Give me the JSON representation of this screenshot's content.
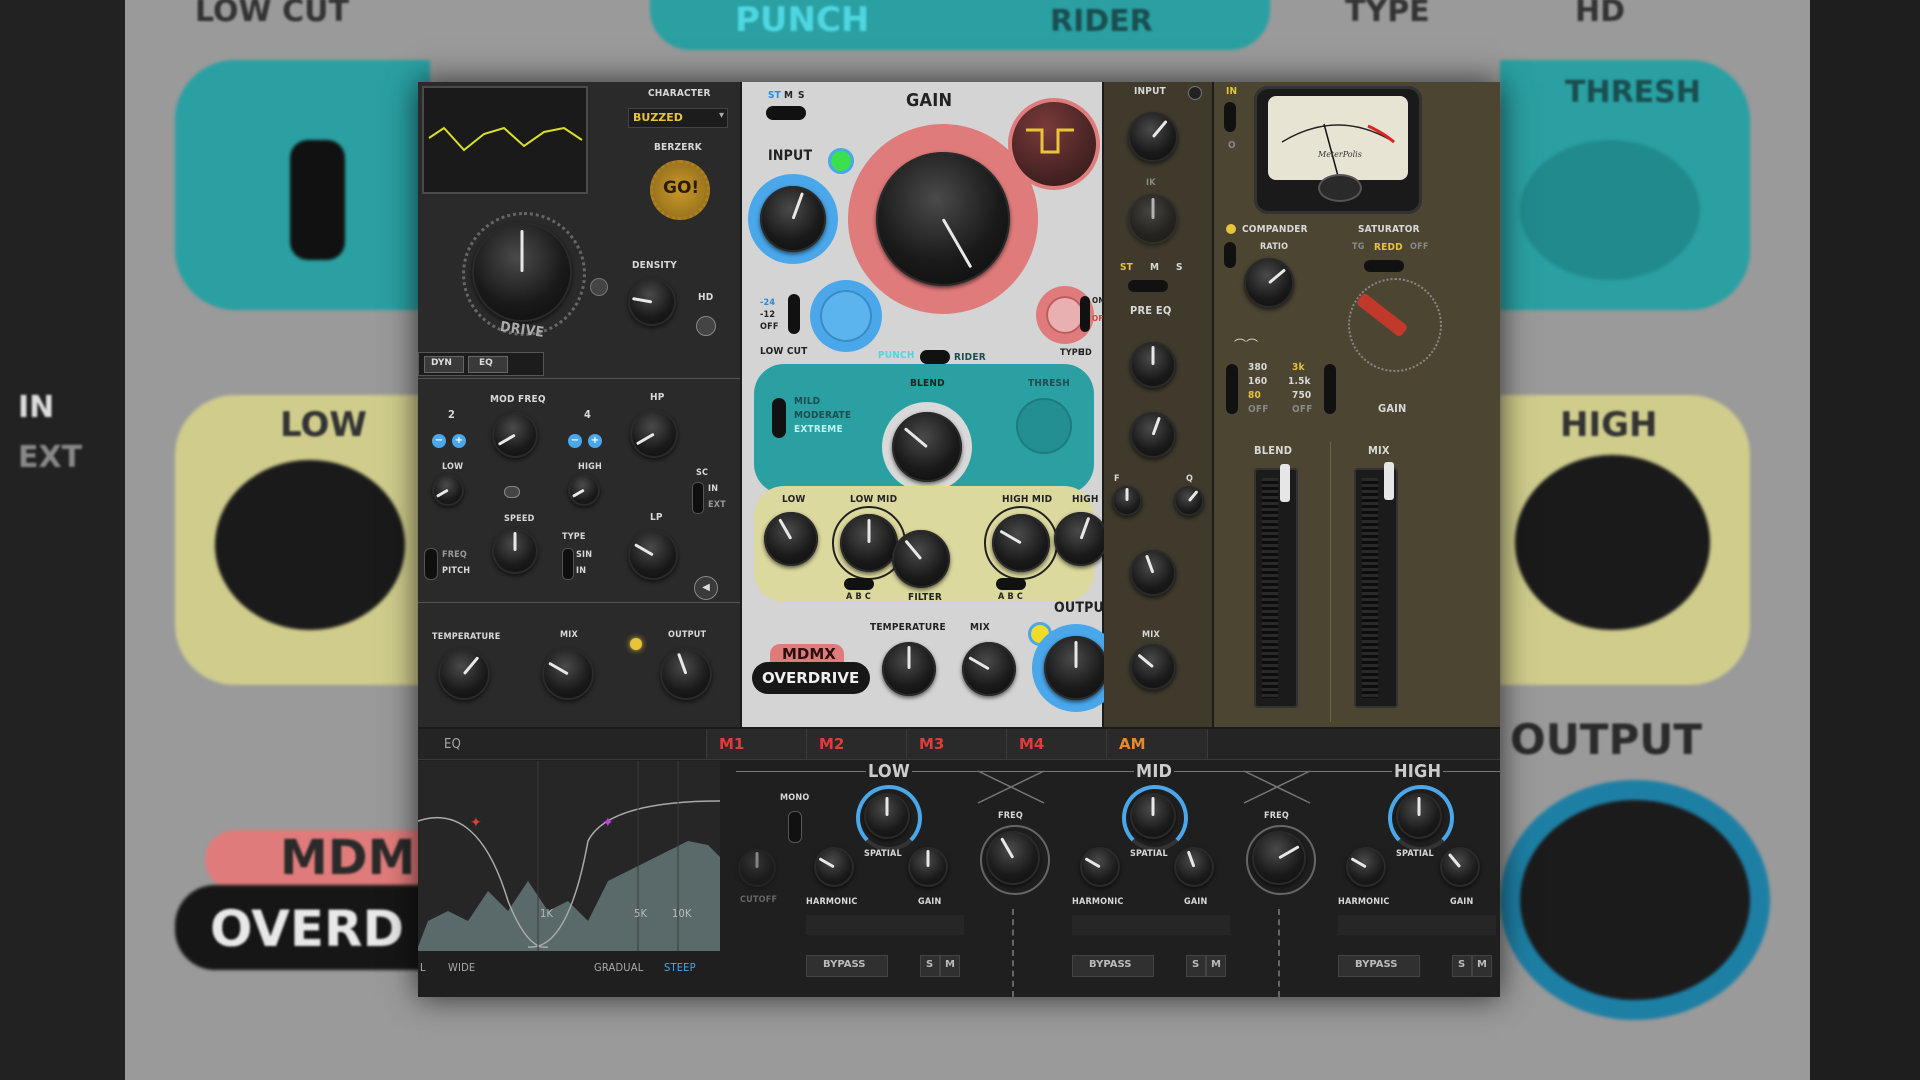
{
  "background": {
    "top_labels": [
      "LOW CUT",
      "PUNCH",
      "RIDER",
      "TYPE",
      "HD"
    ],
    "left_labels": [
      "IN",
      "EXT"
    ],
    "left_knob_label": "LOW",
    "right_knob_label": "HIGH",
    "right_label_top": "THRESH",
    "output_label": "OUTPUT",
    "brand_top": "MDM",
    "brand_bottom": "OVERD"
  },
  "panel1": {
    "character_label": "CHARACTER",
    "character_value": "BUZZED",
    "berzerk_label": "BERZERK",
    "go_label": "GO!",
    "drive_label": "DRIVE",
    "density_label": "DENSITY",
    "hd_label": "HD",
    "tabs": [
      "DYN",
      "EQ"
    ],
    "mod_freq_label": "MOD FREQ",
    "num_left": "2",
    "num_right": "4",
    "hp_label": "HP",
    "lp_label": "LP",
    "low_label": "LOW",
    "high_label": "HIGH",
    "speed_label": "SPEED",
    "type_label": "TYPE",
    "sin_label": "SIN",
    "in_label": "IN",
    "freq_label": "FREQ",
    "pitch_label": "PITCH",
    "sc_label": "SC",
    "sc_in": "IN",
    "sc_ext": "EXT",
    "temperature_label": "TEMPERATURE",
    "mix_label": "MIX",
    "output_label": "OUTPUT"
  },
  "panel2": {
    "mode_st": "ST",
    "mode_m": "M",
    "mode_s": "S",
    "gain_label": "GAIN",
    "input_label": "INPUT",
    "lowcut_options": [
      "-24",
      "-12",
      "OFF"
    ],
    "lowcut_label": "LOW CUT",
    "type_label": "TYPE",
    "hd_label": "HD",
    "hd_on": "ON",
    "hd_off": "OFF",
    "punch_label": "PUNCH",
    "rider_label": "RIDER",
    "mode_options": [
      "MILD",
      "MODERATE",
      "EXTREME"
    ],
    "blend_label": "BLEND",
    "thresh_label": "THRESH",
    "eq_labels": [
      "LOW",
      "LOW MID",
      "HIGH MID",
      "HIGH"
    ],
    "filter_label": "FILTER",
    "abc_left": "A B C",
    "abc_right": "A B C",
    "brand_top": "MDMX",
    "brand_bottom": "OVERDRIVE",
    "temperature_label": "TEMPERATURE",
    "mix_label": "MIX",
    "output_label": "OUTPUT"
  },
  "panel3": {
    "input_label": "INPUT",
    "st_label": "ST",
    "m_label": "M",
    "s_label": "S",
    "pre_eq_label": "PRE EQ",
    "f_label": "F",
    "q_label": "Q",
    "mix_label": "MIX"
  },
  "panel4": {
    "in_label": "IN",
    "o_label": "O",
    "companders_label": "COMPANDER",
    "ratio_label": "RATIO",
    "saturator_label": "SATURATOR",
    "sat_options": [
      "TG",
      "REDD",
      "OFF"
    ],
    "gain_label": "GAIN",
    "freq_low": [
      "380",
      "160",
      "80",
      "OFF"
    ],
    "freq_high": [
      "3k",
      "1.5k",
      "750",
      "OFF"
    ],
    "blend_label": "BLEND",
    "mix_label": "MIX",
    "meter_brand": "MeterPolis"
  },
  "bottom": {
    "eq_tab": "EQ",
    "tabs": [
      "M1",
      "M2",
      "M3",
      "M4",
      "AM"
    ],
    "mono_label": "MONO",
    "cutoff_label": "CUTOFF",
    "bands": [
      {
        "name": "LOW",
        "spatial": "SPATIAL",
        "harmonic": "HARMONIC",
        "gain": "GAIN",
        "bypass": "BYPASS"
      },
      {
        "name": "MID",
        "spatial": "SPATIAL",
        "harmonic": "HARMONIC",
        "gain": "GAIN",
        "bypass": "BYPASS"
      },
      {
        "name": "HIGH",
        "spatial": "SPATIAL",
        "harmonic": "HARMONIC",
        "gain": "GAIN",
        "bypass": "BYPASS"
      }
    ],
    "freq_label": "FREQ",
    "s_label": "S",
    "m_label": "M",
    "graph_labels": [
      "1K",
      "5K",
      "10K"
    ],
    "footer": [
      "L",
      "WIDE",
      "GRADUAL",
      "STEEP"
    ]
  }
}
